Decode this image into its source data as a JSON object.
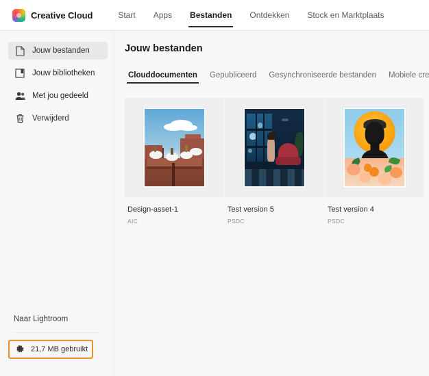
{
  "topnav": {
    "brand": "Creative Cloud",
    "logo_icon": "creative-cloud-logo-icon",
    "items": [
      {
        "label": "Start",
        "active": false
      },
      {
        "label": "Apps",
        "active": false
      },
      {
        "label": "Bestanden",
        "active": true
      },
      {
        "label": "Ontdekken",
        "active": false
      },
      {
        "label": "Stock en Marktplaats",
        "active": false
      }
    ]
  },
  "sidebar": {
    "items": [
      {
        "label": "Jouw bestanden",
        "icon": "file-icon",
        "selected": true
      },
      {
        "label": "Jouw bibliotheken",
        "icon": "library-book-icon",
        "selected": false
      },
      {
        "label": "Met jou gedeeld",
        "icon": "people-shared-icon",
        "selected": false
      },
      {
        "label": "Verwijderd",
        "icon": "trash-icon",
        "selected": false
      }
    ],
    "lightroom_link": "Naar Lightroom",
    "storage": {
      "icon": "gear-icon",
      "label": "21,7 MB gebruikt",
      "highlight_color": "#E5912E"
    }
  },
  "main": {
    "title": "Jouw bestanden",
    "tabs": [
      {
        "label": "Clouddocumenten",
        "active": true
      },
      {
        "label": "Gepubliceerd",
        "active": false
      },
      {
        "label": "Gesynchroniseerde bestanden",
        "active": false
      },
      {
        "label": "Mobiele creaties",
        "active": false
      }
    ],
    "files": [
      {
        "name": "Design-asset-1",
        "type": "AIC",
        "thumb": "desert-canyon-thumbnail"
      },
      {
        "name": "Test version 5",
        "type": "PSDC",
        "thumb": "underwater-room-thumbnail"
      },
      {
        "name": "Test version 4",
        "type": "PSDC",
        "thumb": "sun-portrait-flowers-thumbnail"
      }
    ]
  },
  "colors": {
    "app_background": "#F7F7F7",
    "topnav_background": "#FFFFFF",
    "selected_item": "#E8E8E8",
    "card_background": "#EFEFEF",
    "accent_orange": "#E5912E",
    "text_primary": "#2C2C2C",
    "text_muted": "#909090"
  }
}
